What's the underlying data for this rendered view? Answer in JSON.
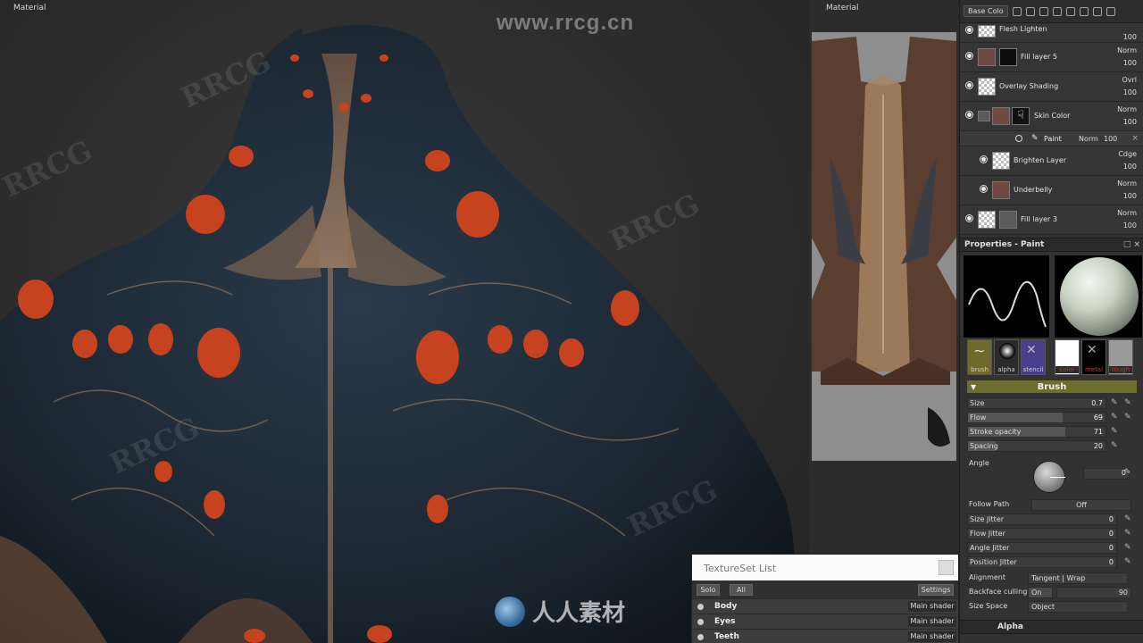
{
  "viewport3d": {
    "label": "Material"
  },
  "viewport2d": {
    "label": "Material"
  },
  "watermarks": {
    "top": "www.rrcg.cn",
    "bottom": "人人素材"
  },
  "toolbar": {
    "channel": "Base Colo",
    "icons": [
      "layers-icon",
      "folder-icon",
      "add-fill-icon",
      "eraser-icon",
      "mask-icon",
      "generator-icon",
      "effect-icon",
      "delete-icon"
    ]
  },
  "layers": [
    {
      "name": "Flesh Lighten",
      "blend": "",
      "opacity": "100"
    },
    {
      "name": "Fill layer 5",
      "blend": "Norm",
      "opacity": "100"
    },
    {
      "name": "Overlay Shading",
      "blend": "Ovrl",
      "opacity": "100"
    },
    {
      "name": "Skin Color",
      "blend": "Norm",
      "opacity": "100"
    },
    {
      "name": "Brighten Layer",
      "blend": "Cdge",
      "opacity": "100"
    },
    {
      "name": "Underbelly",
      "blend": "Norm",
      "opacity": "100"
    },
    {
      "name": "Fill layer 3",
      "blend": "Norm",
      "opacity": "100"
    }
  ],
  "paint_sublayer": {
    "name": "Paint",
    "blend": "Norm",
    "opacity": "100"
  },
  "properties": {
    "title": "Properties - Paint",
    "slots": [
      "brush",
      "alpha",
      "stencil",
      "color",
      "metal",
      "rough"
    ],
    "brush_header": "Brush",
    "size": {
      "label": "Size",
      "value": "0.7",
      "fraction": 0.0
    },
    "flow": {
      "label": "Flow",
      "value": "69",
      "fraction": 0.69
    },
    "stroke_opacity": {
      "label": "Stroke opacity",
      "value": "71",
      "fraction": 0.71
    },
    "spacing": {
      "label": "Spacing",
      "value": "20",
      "fraction": 0.2
    },
    "angle": {
      "label": "Angle",
      "value": "0"
    },
    "follow_path": {
      "label": "Follow Path",
      "value": "Off"
    },
    "size_jitter": {
      "label": "Size Jitter",
      "value": "0"
    },
    "flow_jitter": {
      "label": "Flow Jitter",
      "value": "0"
    },
    "angle_jitter": {
      "label": "Angle Jitter",
      "value": "0"
    },
    "position_jitter": {
      "label": "Position Jitter",
      "value": "0"
    },
    "alignment": {
      "label": "Alignment",
      "value": "Tangent | Wrap"
    },
    "backface_culling": {
      "label": "Backface culling",
      "value": "On",
      "amount": "90"
    },
    "size_space": {
      "label": "Size Space",
      "value": "Object"
    },
    "alpha_header": "Alpha"
  },
  "textureset": {
    "title": "TextureSet List",
    "solo": "Solo",
    "all": "All",
    "settings": "Settings",
    "rows": [
      {
        "name": "Body",
        "shader": "Main shader"
      },
      {
        "name": "Eyes",
        "shader": "Main shader"
      },
      {
        "name": "Teeth",
        "shader": "Main shader"
      }
    ]
  }
}
